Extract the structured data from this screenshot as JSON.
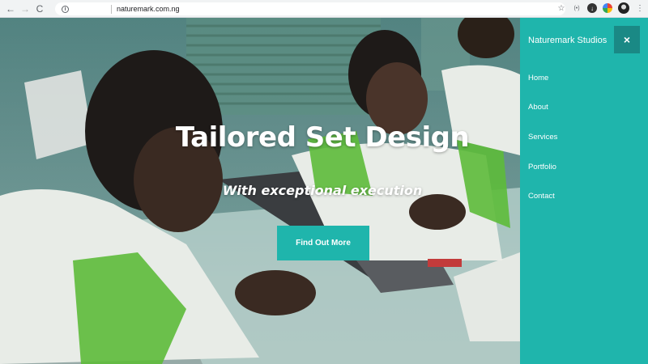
{
  "browser": {
    "url": "naturemark.com.ng",
    "back_icon": "←",
    "forward_icon": "→",
    "reload_icon": "C",
    "info_icon": "i",
    "star_icon": "☆",
    "ext_cast_label": "(•)"
  },
  "hero": {
    "title": "Tailored Set Design",
    "subtitle": "With exceptional execution",
    "cta_label": "Find Out More"
  },
  "sidemenu": {
    "brand": "Naturemark Studios",
    "close_icon": "×",
    "items": [
      {
        "label": "Home"
      },
      {
        "label": "About"
      },
      {
        "label": "Services"
      },
      {
        "label": "Portfolio"
      },
      {
        "label": "Contact"
      }
    ]
  },
  "colors": {
    "accent": "#1fb5ac",
    "close_bg": "#1a8985"
  }
}
